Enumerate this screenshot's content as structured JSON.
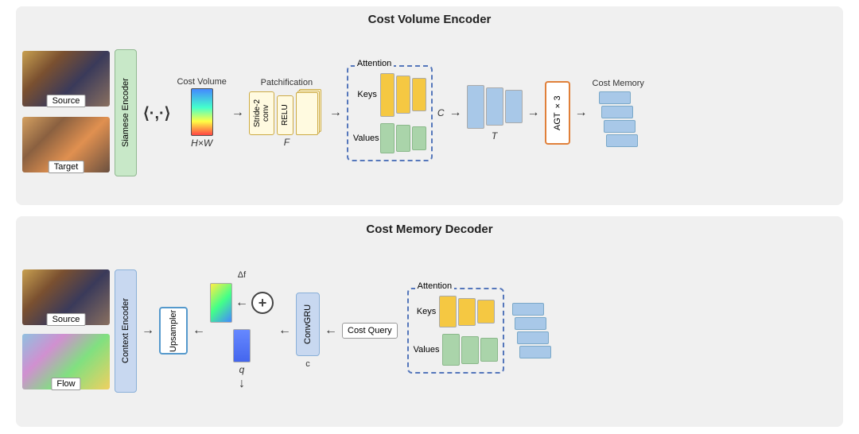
{
  "top": {
    "title": "Cost Volume Encoder",
    "source_label": "Source",
    "target_label": "Target",
    "siamese_encoder": "Siamese Encoder",
    "cost_volume_label": "Cost Volume",
    "patchification_label": "Patchification",
    "hw_label": "H×W",
    "stride2_label": "Stride-2 conv",
    "relu_label": "RELU",
    "f_label": "F",
    "attention_label": "Attention",
    "keys_label": "Keys",
    "values_label": "Values",
    "c_label": "C",
    "t_label": "T",
    "agt_label": "AGT ×3",
    "cost_memory_label": "Cost Memory"
  },
  "bottom": {
    "title": "Cost Memory Decoder",
    "source_label": "Source",
    "flow_label": "Flow",
    "context_encoder": "Context Encoder",
    "upsampler_label": "Upsampler",
    "delta_f_label": "Δf",
    "convgru_label": "ConvGRU",
    "c_label": "c",
    "cost_query_label": "Cost Query",
    "q_label": "q",
    "attention_label": "Attention",
    "keys_label": "Keys",
    "values_label": "Values",
    "plus_symbol": "+"
  },
  "arrows": {
    "right": "→",
    "left": "←",
    "down": "↓",
    "up": "↑"
  }
}
